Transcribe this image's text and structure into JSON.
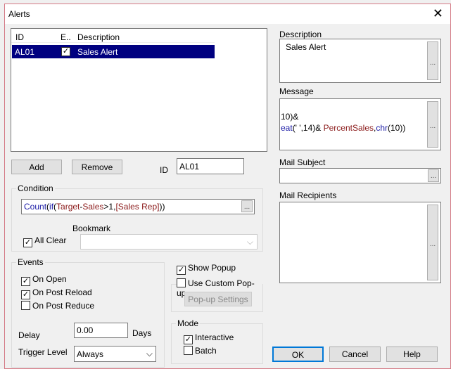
{
  "title": "Alerts",
  "list": {
    "headers": [
      "ID",
      "E..",
      "Description"
    ],
    "rows": [
      {
        "id": "AL01",
        "enabled": true,
        "description": "Sales Alert"
      }
    ]
  },
  "buttons": {
    "add": "Add",
    "remove": "Remove",
    "popup_settings": "Pop-up Settings",
    "ok": "OK",
    "cancel": "Cancel",
    "help": "Help",
    "ellipsis": "..."
  },
  "id_label": "ID",
  "id_value": "AL01",
  "condition": {
    "label": "Condition",
    "expr": {
      "p1": "Count",
      "p2": "(",
      "p3": "if",
      "p4": "(",
      "p5": "Target",
      "p6": "-",
      "p7": "Sales",
      "p8": ">1,",
      "p9": "[Sales Rep]",
      "p10": "))"
    },
    "all_clear": "All Clear",
    "bookmark_label": "Bookmark",
    "bookmark_value": ""
  },
  "events": {
    "label": "Events",
    "on_open": "On Open",
    "on_post_reload": "On Post Reload",
    "on_post_reduce": "On Post Reduce",
    "delay_label": "Delay",
    "delay_value": "0.00",
    "days": "Days",
    "trigger_label": "Trigger Level",
    "trigger_value": "Always"
  },
  "popup": {
    "show": "Show Popup",
    "custom": "Use Custom Pop-up"
  },
  "mode": {
    "label": "Mode",
    "interactive": "Interactive",
    "batch": "Batch"
  },
  "right": {
    "description_label": "Description",
    "description_value": "Sales Alert",
    "message_label": "Message",
    "message_line1": "10)&",
    "msg_a": "eat",
    "msg_b": "(' ',14)& ",
    "msg_c": "PercentSales",
    "msg_d": ",",
    "msg_e": "chr",
    "msg_f": "(10))",
    "mail_subject_label": "Mail Subject",
    "mail_recipients_label": "Mail Recipients"
  },
  "check": "✓"
}
